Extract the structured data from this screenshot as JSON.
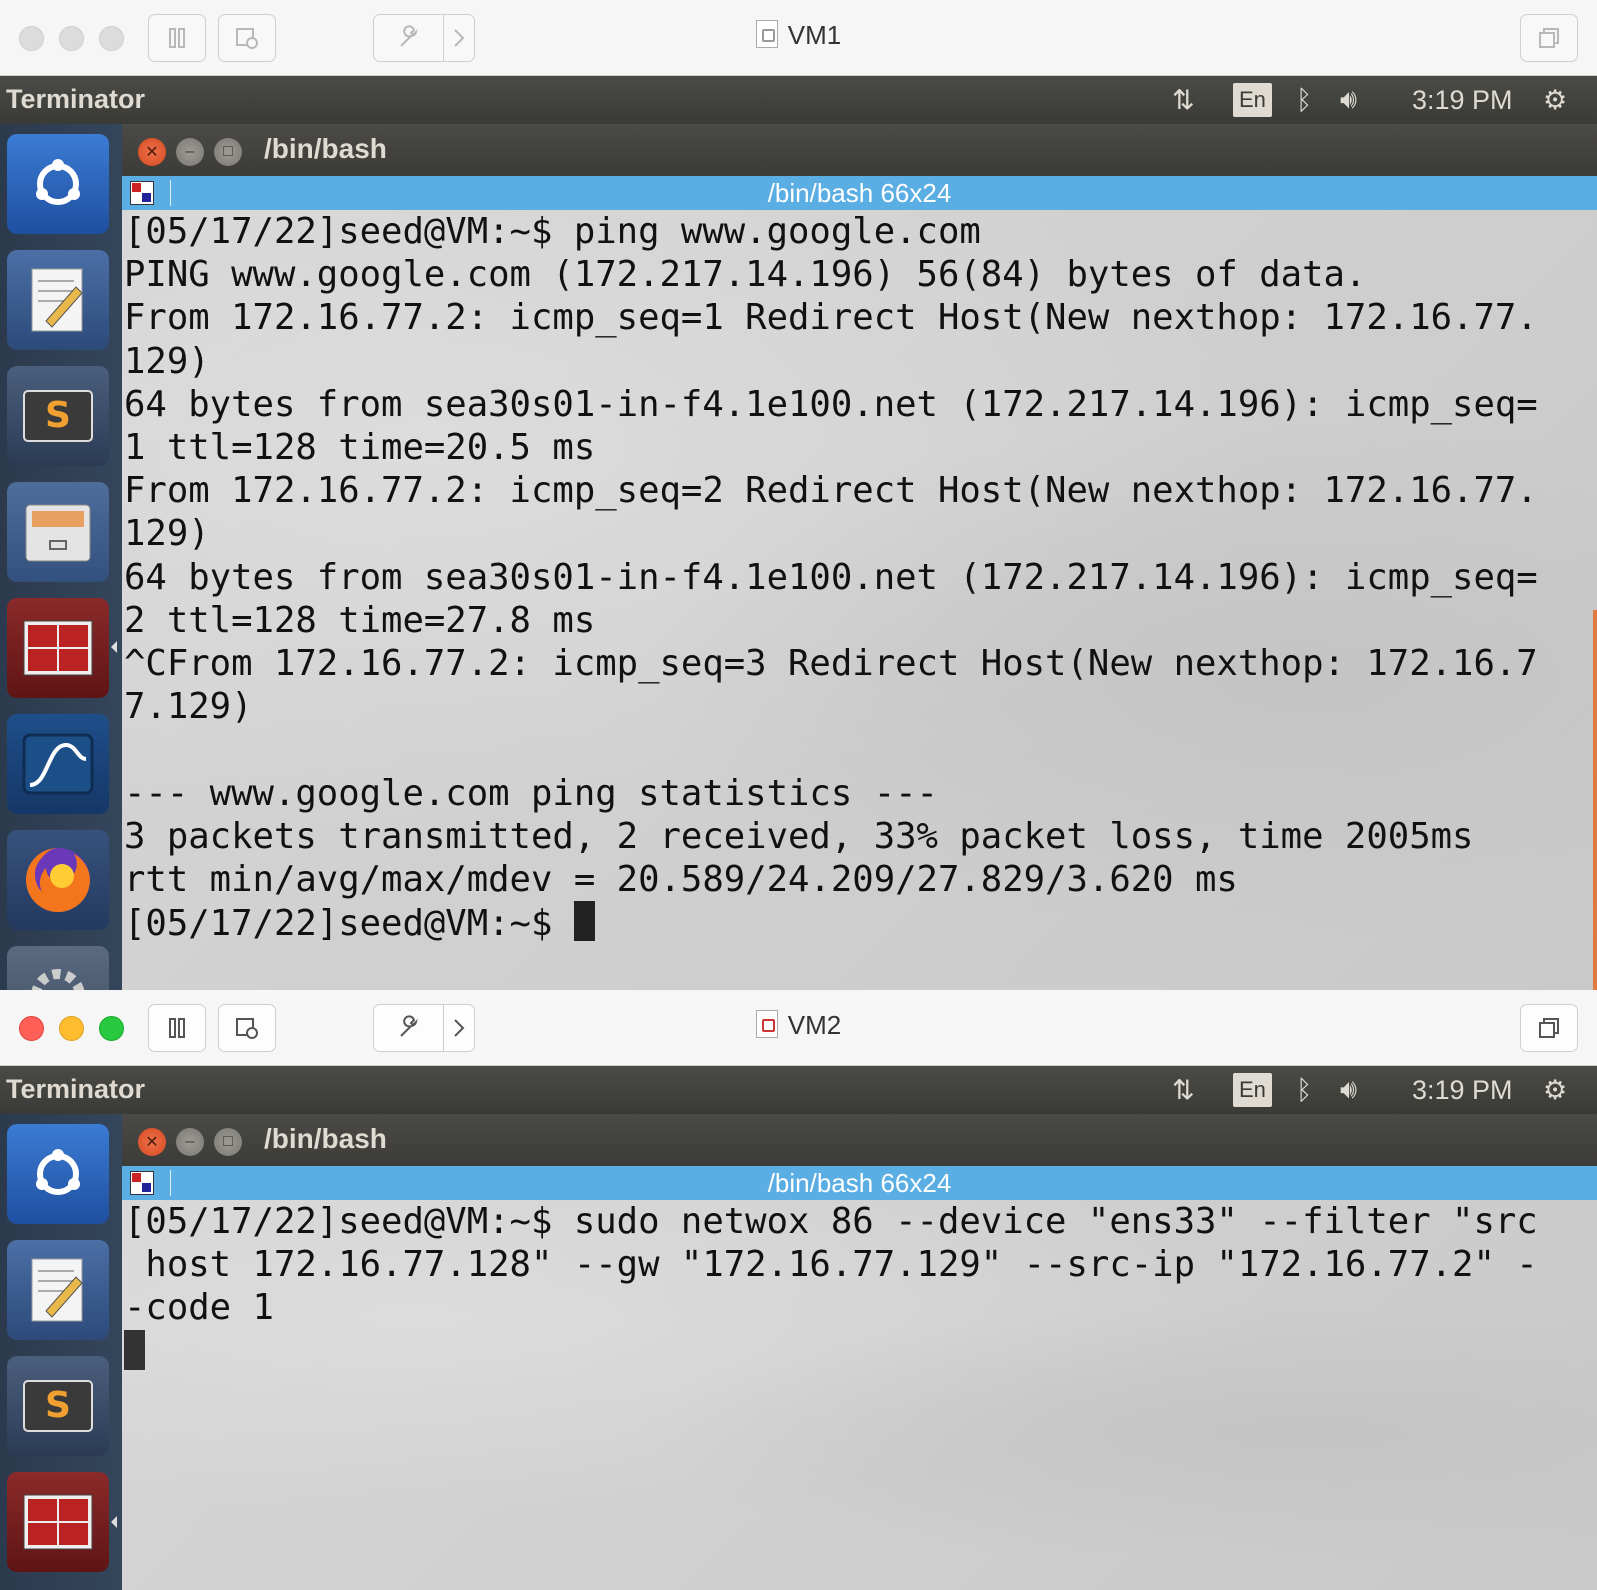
{
  "vm1": {
    "window_title": "VM1",
    "panel": {
      "app_name": "Terminator",
      "lang": "En",
      "time": "3:19 PM"
    },
    "terminator": {
      "window_title": "/bin/bash",
      "tab_title": "/bin/bash 66x24",
      "lines": [
        "[05/17/22]seed@VM:~$ ping www.google.com",
        "PING www.google.com (172.217.14.196) 56(84) bytes of data.",
        "From 172.16.77.2: icmp_seq=1 Redirect Host(New nexthop: 172.16.77.",
        "129)",
        "64 bytes from sea30s01-in-f4.1e100.net (172.217.14.196): icmp_seq=",
        "1 ttl=128 time=20.5 ms",
        "From 172.16.77.2: icmp_seq=2 Redirect Host(New nexthop: 172.16.77.",
        "129)",
        "64 bytes from sea30s01-in-f4.1e100.net (172.217.14.196): icmp_seq=",
        "2 ttl=128 time=27.8 ms",
        "^CFrom 172.16.77.2: icmp_seq=3 Redirect Host(New nexthop: 172.16.7",
        "7.129)",
        "",
        "--- www.google.com ping statistics ---",
        "3 packets transmitted, 2 received, 33% packet loss, time 2005ms",
        "rtt min/avg/max/mdev = 20.589/24.209/27.829/3.620 ms"
      ],
      "prompt": "[05/17/22]seed@VM:~$ "
    }
  },
  "vm2": {
    "window_title": "VM2",
    "panel": {
      "app_name": "Terminator",
      "lang": "En",
      "time": "3:19 PM"
    },
    "terminator": {
      "window_title": "/bin/bash",
      "tab_title": "/bin/bash 66x24",
      "lines": [
        "[05/17/22]seed@VM:~$ sudo netwox 86 --device \"ens33\" --filter \"src",
        " host 172.16.77.128\" --gw \"172.16.77.129\" --src-ip \"172.16.77.2\" -",
        "-code 1"
      ]
    }
  },
  "launcher_items": [
    "ubuntu-dash",
    "text-editor",
    "sublime-text",
    "file-manager",
    "terminator",
    "wireshark",
    "firefox",
    "system-settings"
  ],
  "colors": {
    "tab_bar": "#5aaee3",
    "panel": "#3c3b37",
    "close_button": "#e05a2e",
    "launcher": "#2c3a4d"
  }
}
